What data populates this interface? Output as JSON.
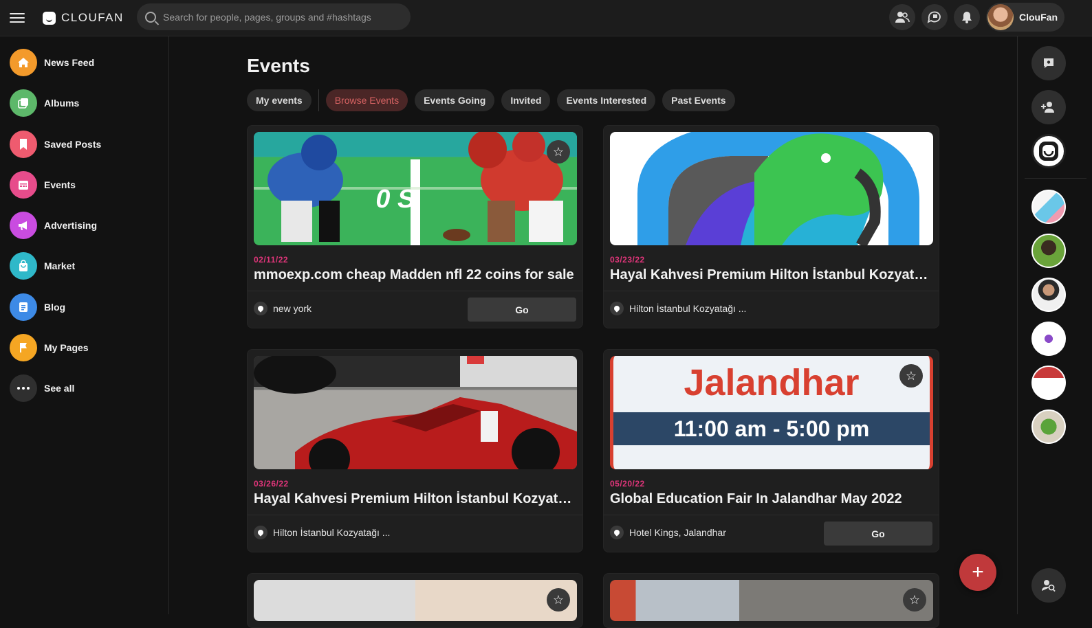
{
  "header": {
    "logo_text": "CLOUFAN",
    "search_placeholder": "Search for people, pages, groups and #hashtags",
    "user_name": "ClouFan"
  },
  "sidebar": {
    "items": [
      {
        "label": "News Feed",
        "icon": "home-icon",
        "color": "#f39a2b"
      },
      {
        "label": "Albums",
        "icon": "albums-icon",
        "color": "#5db86a"
      },
      {
        "label": "Saved Posts",
        "icon": "bookmark-icon",
        "color": "#ef5b6f"
      },
      {
        "label": "Events",
        "icon": "calendar-icon",
        "color": "#e74c8b"
      },
      {
        "label": "Advertising",
        "icon": "megaphone-icon",
        "color": "#c94ce0"
      },
      {
        "label": "Market",
        "icon": "shopping-bag-icon",
        "color": "#2fb8c9"
      },
      {
        "label": "Blog",
        "icon": "blog-icon",
        "color": "#3d8ae6"
      },
      {
        "label": "My Pages",
        "icon": "flag-icon",
        "color": "#f5a623"
      },
      {
        "label": "See all",
        "icon": "more-icon",
        "color": "#2f2f2f"
      }
    ]
  },
  "main": {
    "title": "Events",
    "tabs": [
      "My events",
      "Browse Events",
      "Events Going",
      "Invited",
      "Events Interested",
      "Past Events"
    ],
    "active_tab": "Browse Events",
    "events": [
      {
        "date": "02/11/22",
        "title": "mmoexp.com cheap Madden nfl 22 coins for sale",
        "location": "new york",
        "action": "Go",
        "image": "football"
      },
      {
        "date": "03/23/22",
        "title": "Hayal Kahvesi Premium Hilton İstanbul Kozyatağı'n...",
        "location": "Hilton İstanbul Kozyatağı ...",
        "action": "",
        "image": "logo"
      },
      {
        "date": "03/26/22",
        "title": "Hayal Kahvesi Premium Hilton İstanbul Kozyatağı'n...",
        "location": "Hilton İstanbul Kozyatağı ...",
        "action": "",
        "image": "f1"
      },
      {
        "date": "05/20/22",
        "title": "Global Education Fair In Jalandhar May 2022",
        "location": "Hotel Kings, Jalandhar",
        "action": "Go",
        "image": "jalandhar",
        "image_text_city": "Jalandhar",
        "image_text_time": "11:00 am - 5:00 pm"
      }
    ]
  },
  "rail": {
    "buttons": [
      "chat-settings-icon",
      "add-friend-icon",
      "cloufan-logo-icon"
    ]
  }
}
